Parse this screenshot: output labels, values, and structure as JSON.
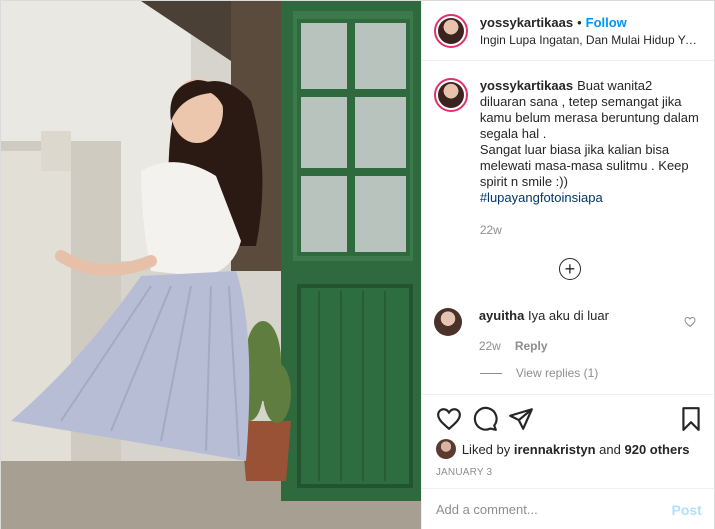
{
  "header": {
    "username": "yossykartikaas",
    "separator": "•",
    "follow_label": "Follow",
    "location": "Ingin Lupa Ingatan, Dan Mulai Hidup Yang Baru"
  },
  "caption": {
    "username": "yossykartikaas",
    "text": "Buat wanita2 diluaran sana , tetep semangat jika kamu belum merasa beruntung dalam segala hal .\nSangat luar biasa jika kalian bisa melewati masa-masa sulitmu . Keep spirit n smile :))",
    "hashtag": "#lupayangfotoinsiapa",
    "time": "22w"
  },
  "load_more_icon": "plus-circle-icon",
  "comment": {
    "username": "ayuitha",
    "text": "Iya aku di luar",
    "time": "22w",
    "reply_label": "Reply",
    "view_replies": "View replies (1)"
  },
  "actions": {
    "icons": [
      "heart-icon",
      "comment-icon",
      "share-icon",
      "bookmark-icon"
    ]
  },
  "likes": {
    "prefix": "Liked by",
    "user": "irennakristyn",
    "middle": "and",
    "others": "920 others"
  },
  "date": "JANUARY 3",
  "add_comment": {
    "placeholder": "Add a comment...",
    "post_label": "Post"
  },
  "colors": {
    "link_blue": "#0095f6",
    "post_disabled": "#b2dffc",
    "muted": "#8e8e8e"
  }
}
